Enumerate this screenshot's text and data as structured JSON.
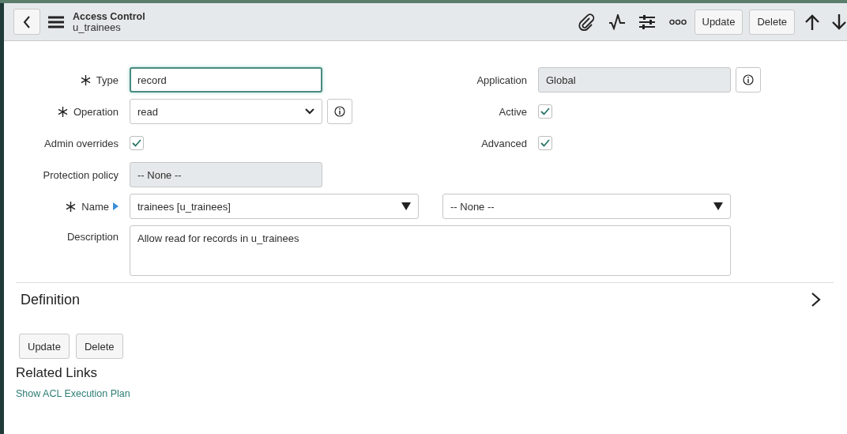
{
  "header": {
    "title": "Access Control",
    "subtitle": "u_trainees",
    "buttons": [
      "Update",
      "Delete"
    ]
  },
  "form": {
    "rows": [
      {
        "left": {
          "kind": "text",
          "label": "Type",
          "required": true,
          "value": "record",
          "readonly": false,
          "focused": true,
          "info": false
        },
        "right": {
          "kind": "text",
          "label": "Application",
          "required": false,
          "value": "Global",
          "readonly": true,
          "focused": false,
          "info": true
        }
      },
      {
        "left": {
          "kind": "select",
          "label": "Operation",
          "required": true,
          "value": "read",
          "info": true
        },
        "right": {
          "kind": "checkbox",
          "label": "Active",
          "checked": true
        }
      },
      {
        "left": {
          "kind": "checkbox",
          "label": "Admin overrides",
          "checked": true
        },
        "right": {
          "kind": "checkbox",
          "label": "Advanced",
          "checked": true
        }
      },
      {
        "left": {
          "kind": "text",
          "label": "Protection policy",
          "required": false,
          "value": "-- None --",
          "readonly": true,
          "focused": false,
          "info": false
        }
      }
    ],
    "name": {
      "label": "Name",
      "required": true,
      "table": "trainees [u_trainees]",
      "field": "-- None --"
    },
    "description": {
      "label": "Description",
      "value": "Allow read for records in u_trainees"
    }
  },
  "section": {
    "title": "Definition",
    "expanded": false
  },
  "buttons": [
    "Update",
    "Delete"
  ],
  "related_links": {
    "title": "Related Links",
    "links": [
      "Show ACL Execution Plan"
    ]
  }
}
